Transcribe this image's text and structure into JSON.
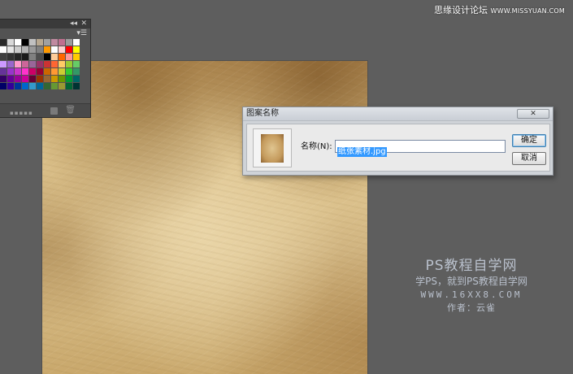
{
  "top_watermark": {
    "label": "思缘设计论坛",
    "site": "WWW.MISSYUAN.COM"
  },
  "swatches_panel": {
    "collapse_glyph": "◂◂",
    "close_glyph": "✕",
    "menu_glyph": "▾☰",
    "trash_glyph": "🗑",
    "colors": [
      "#2a2a2a",
      "#d8d8d8",
      "#ffffff",
      "#000000",
      "#c0c0c0",
      "#b8a890",
      "#a0a0a0",
      "#c08aa0",
      "#c07090",
      "#9c9c9c",
      "#ffffff",
      "#ffffff",
      "#e6e6e6",
      "#cccccc",
      "#b3b3b3",
      "#999999",
      "#808080",
      "#ff9900",
      "#ffffff",
      "#ffd0d0",
      "#ff0000",
      "#ffff00",
      "#404040",
      "#333333",
      "#262626",
      "#1a1a1a",
      "#808080",
      "#4d4d4d",
      "#000000",
      "#ffcc99",
      "#ff6600",
      "#ff9999",
      "#ffcc00",
      "#cc99ff",
      "#9966cc",
      "#ff99cc",
      "#cc6699",
      "#996699",
      "#993366",
      "#cc3333",
      "#ff6633",
      "#ffcc66",
      "#99cc33",
      "#66cc66",
      "#663399",
      "#9933cc",
      "#cc33cc",
      "#ff33cc",
      "#cc0066",
      "#990033",
      "#cc6600",
      "#ff9933",
      "#cccc33",
      "#33cc33",
      "#339966",
      "#330066",
      "#660099",
      "#990099",
      "#cc0099",
      "#660033",
      "#993300",
      "#996633",
      "#cc9900",
      "#669900",
      "#009933",
      "#006666",
      "#000066",
      "#330099",
      "#003399",
      "#0066cc",
      "#3399cc",
      "#006699",
      "#336633",
      "#669933",
      "#999933",
      "#006633",
      "#003333"
    ]
  },
  "dialog": {
    "title": "图案名称",
    "close_glyph": "✕",
    "name_label": "名称(N):",
    "name_value": "纸张素材.jpg",
    "ok_label": "确定",
    "cancel_label": "取消"
  },
  "watermark": {
    "title": "PS教程自学网",
    "subtitle": "学PS，就到PS教程自学网",
    "url": "WWW.16XX8.COM",
    "author": "作者：云雀"
  }
}
